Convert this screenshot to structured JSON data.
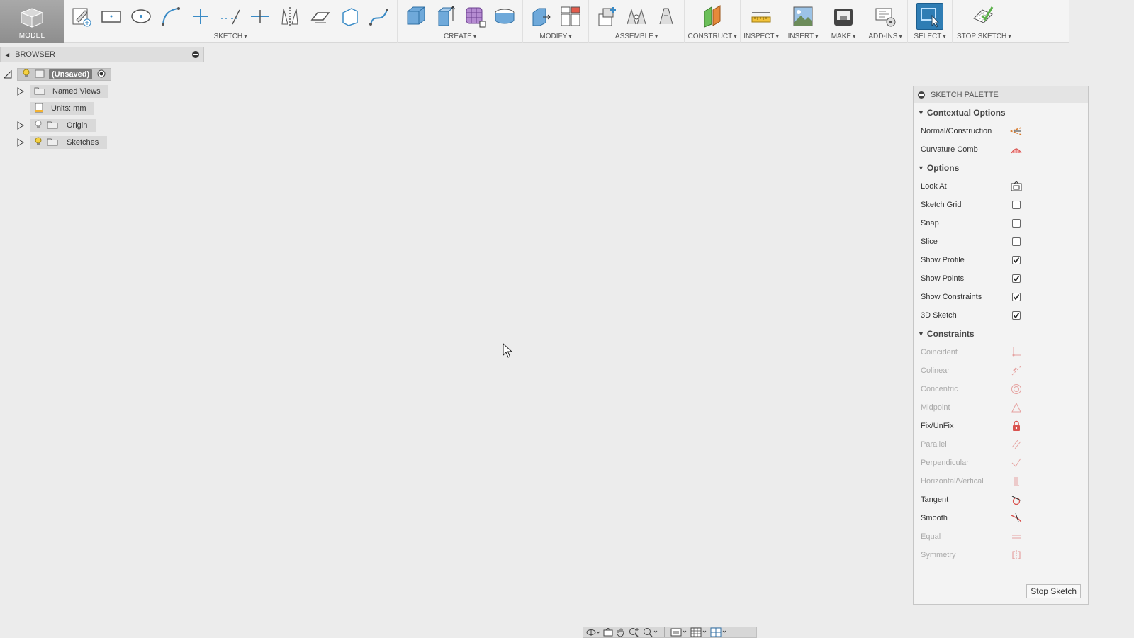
{
  "toolbar": {
    "model_label": "MODEL",
    "groups": {
      "sketch": "SKETCH",
      "create": "CREATE",
      "modify": "MODIFY",
      "assemble": "ASSEMBLE",
      "construct": "CONSTRUCT",
      "inspect": "INSPECT",
      "insert": "INSERT",
      "make": "MAKE",
      "addins": "ADD-INS",
      "select": "SELECT",
      "stop_sketch": "STOP SKETCH"
    }
  },
  "browser": {
    "title": "BROWSER",
    "root": "(Unsaved)",
    "items": [
      {
        "label": "Named Views"
      },
      {
        "label": "Units: mm"
      },
      {
        "label": "Origin"
      },
      {
        "label": "Sketches"
      }
    ]
  },
  "palette": {
    "title": "SKETCH PALETTE",
    "sections": {
      "contextual": "Contextual Options",
      "options": "Options",
      "constraints": "Constraints"
    },
    "contextual": [
      {
        "label": "Normal/Construction",
        "icon": "normal-construction-icon"
      },
      {
        "label": "Curvature Comb",
        "icon": "curvature-comb-icon"
      }
    ],
    "options": [
      {
        "label": "Look At",
        "type": "icon",
        "icon": "look-at-icon"
      },
      {
        "label": "Sketch Grid",
        "checked": false
      },
      {
        "label": "Snap",
        "checked": false
      },
      {
        "label": "Slice",
        "checked": false
      },
      {
        "label": "Show Profile",
        "checked": true
      },
      {
        "label": "Show Points",
        "checked": true
      },
      {
        "label": "Show Constraints",
        "checked": true
      },
      {
        "label": "3D Sketch",
        "checked": true
      }
    ],
    "constraints": [
      {
        "label": "Coincident",
        "enabled": false,
        "icon": "coincident-icon"
      },
      {
        "label": "Colinear",
        "enabled": false,
        "icon": "colinear-icon"
      },
      {
        "label": "Concentric",
        "enabled": false,
        "icon": "concentric-icon"
      },
      {
        "label": "Midpoint",
        "enabled": false,
        "icon": "midpoint-icon"
      },
      {
        "label": "Fix/UnFix",
        "enabled": true,
        "icon": "lock-icon"
      },
      {
        "label": "Parallel",
        "enabled": false,
        "icon": "parallel-icon"
      },
      {
        "label": "Perpendicular",
        "enabled": false,
        "icon": "perpendicular-icon"
      },
      {
        "label": "Horizontal/Vertical",
        "enabled": false,
        "icon": "horizontal-vertical-icon"
      },
      {
        "label": "Tangent",
        "enabled": true,
        "icon": "tangent-icon"
      },
      {
        "label": "Smooth",
        "enabled": true,
        "icon": "smooth-icon"
      },
      {
        "label": "Equal",
        "enabled": false,
        "icon": "equal-icon"
      },
      {
        "label": "Symmetry",
        "enabled": false,
        "icon": "symmetry-icon"
      }
    ],
    "stop_button": "Stop Sketch"
  },
  "colors": {
    "accent": "#2f7db4",
    "constraint_icon": "#d9534f"
  }
}
